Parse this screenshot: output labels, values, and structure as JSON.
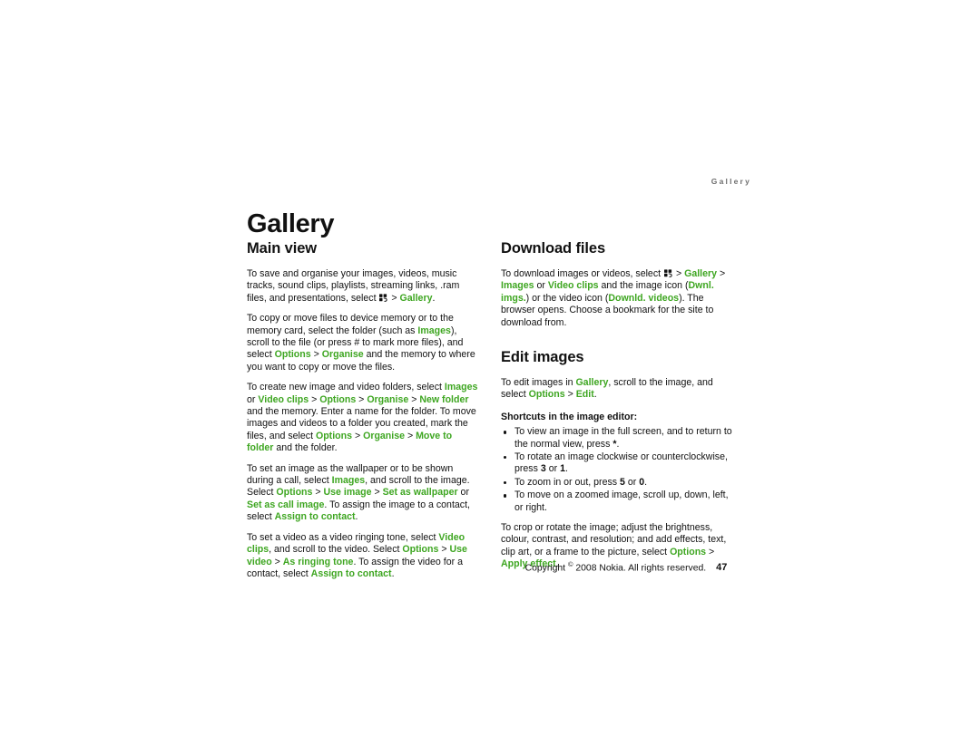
{
  "header": {
    "running_title": "Gallery"
  },
  "chapter": {
    "title": "Gallery"
  },
  "left_column": {
    "section_title": "Main view",
    "paragraph_1": {
      "pre_icon": "To save and organise your images, videos, music tracks, sound clips, playlists, streaming links, .ram files, and presentations, select ",
      "icon": "menu-key-icon",
      "sep": " > ",
      "link": "Gallery",
      "post": "."
    },
    "paragraph_2": {
      "t1": "To copy or move files to device memory or to the memory card, select the folder (such as ",
      "g1": "Images",
      "t2": "), scroll to the file (or press # to mark more files), and select ",
      "g2": "Options",
      "t3": " > ",
      "g3": "Organise",
      "t4": " and the memory to where you want to copy or move the files."
    },
    "paragraph_3": {
      "t1": "To create new image and video folders, select ",
      "g1": "Images",
      "t2": " or ",
      "g2": "Video clips",
      "t3": " > ",
      "g3": "Options",
      "t4": " > ",
      "g4": "Organise",
      "t5": " > ",
      "g5": "New folder",
      "t6": " and the memory. Enter a name for the folder. To move images and videos to a folder you created, mark the files, and select ",
      "g6": "Options",
      "t7": " > ",
      "g7": "Organise",
      "t8": " > ",
      "g8": "Move to folder",
      "t9": " and the folder."
    },
    "paragraph_4": {
      "t1": "To set an image as the wallpaper or to be shown during a call, select ",
      "g1": "Images",
      "t2": ", and scroll to the image. Select ",
      "g2": "Options",
      "t3": " > ",
      "g3": "Use image",
      "t4": " > ",
      "g4": "Set as wallpaper",
      "t5": " or ",
      "g5": "Set as call image",
      "t6": ". To assign the image to a contact, select ",
      "g6": "Assign to contact",
      "t7": "."
    },
    "paragraph_5": {
      "t1": "To set a video as a video ringing tone, select ",
      "g1": "Video clips",
      "t2": ", and scroll to the video. Select ",
      "g2": "Options",
      "t3": " > ",
      "g3": "Use video",
      "t4": " > ",
      "g4": "As ringing tone",
      "t5": ". To assign the video for a contact, select ",
      "g5": "Assign to contact",
      "t6": "."
    }
  },
  "right_column": {
    "section_title_download": "Download files",
    "paragraph_download": {
      "t1": "To download images or videos, select ",
      "icon": "menu-key-icon",
      "t2": " > ",
      "g1": "Gallery",
      "t3": " > ",
      "g2": "Images",
      "t4": " or ",
      "g3": "Video clips",
      "t5": " and the image icon (",
      "g4": "Dwnl. imgs.",
      "t6": ") or the video icon (",
      "g5": "Downld. videos",
      "t7": "). The browser opens. Choose a bookmark for the site to download from."
    },
    "section_title_edit": "Edit images",
    "paragraph_edit": {
      "t1": "To edit images in ",
      "g1": "Gallery",
      "t2": ", scroll to the image, and select ",
      "g2": "Options",
      "t3": " > ",
      "g3": "Edit",
      "t4": "."
    },
    "shortcuts_label": "Shortcuts in the image editor:",
    "shortcuts": [
      {
        "t1": "To view an image in the full screen, and to return to the normal view, press ",
        "b1": "*",
        "t2": "."
      },
      {
        "t1": "To rotate an image clockwise or counterclockwise, press ",
        "b1": "3",
        "t2": " or ",
        "b2": "1",
        "t3": "."
      },
      {
        "t1": "To zoom in or out, press ",
        "b1": "5",
        "t2": " or ",
        "b2": "0",
        "t3": "."
      },
      {
        "t1": "To move on a zoomed image, scroll up, down, left, or right.",
        "b1": "",
        "t2": ""
      }
    ],
    "paragraph_crop": {
      "t1": "To crop or rotate the image; adjust the brightness, colour, contrast, and resolution; and add effects, text, clip art, or a frame to the picture, select ",
      "g1": "Options",
      "t2": " > ",
      "g2": "Apply effect",
      "t3": "."
    }
  },
  "footer": {
    "copyright_pre": "Copyright ",
    "copyright_symbol": "©",
    "copyright_post": " 2008 Nokia. All rights reserved.",
    "page_number": "47"
  },
  "colors": {
    "link_green": "#3ea621",
    "body_text": "#111111",
    "header_gray": "#6e6e6e",
    "page_background": "#ffffff"
  }
}
